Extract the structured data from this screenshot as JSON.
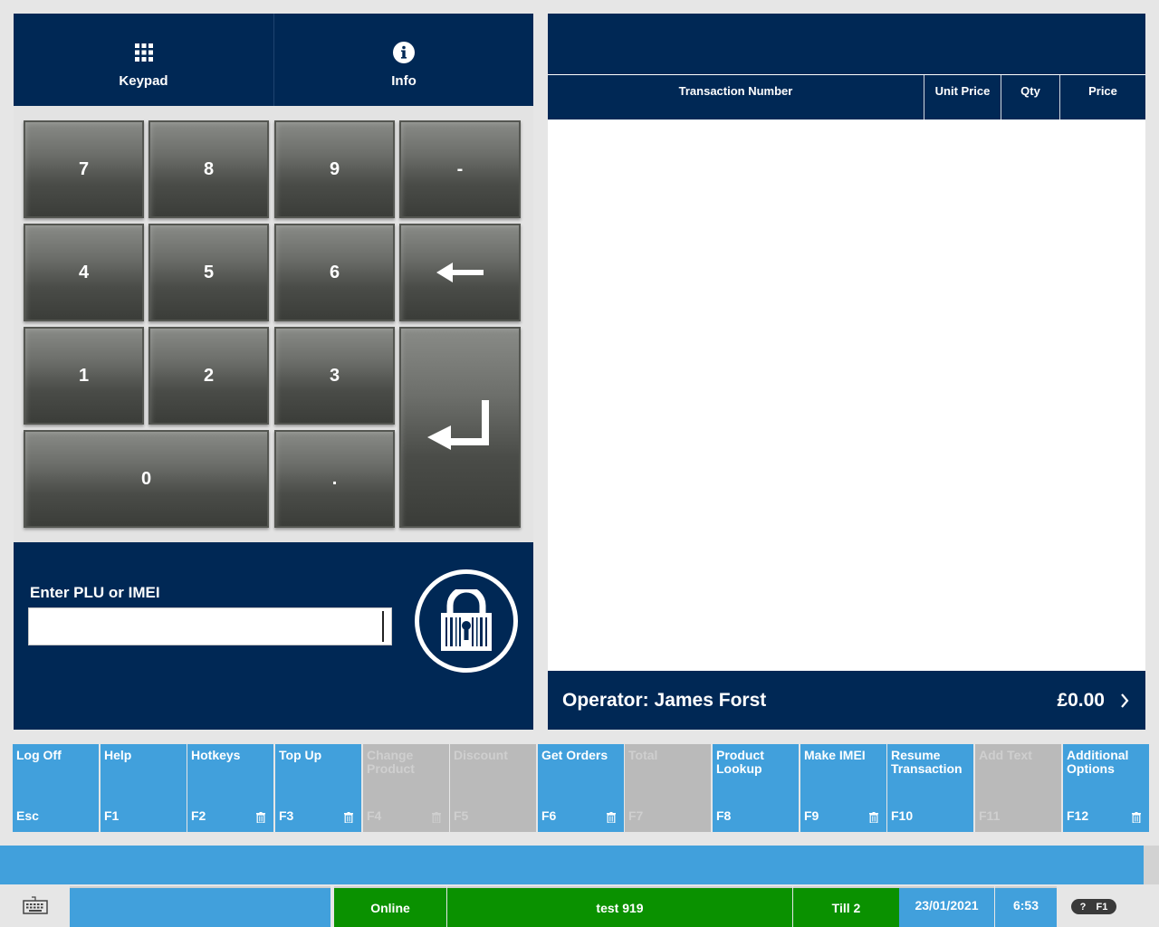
{
  "tabs": [
    {
      "label": "Keypad",
      "icon": "grid-icon"
    },
    {
      "label": "Info",
      "icon": "info-icon"
    }
  ],
  "keypad": {
    "keys": [
      "7",
      "8",
      "9",
      "-",
      "4",
      "5",
      "6",
      "backspace",
      "1",
      "2",
      "3",
      "enter",
      "0",
      "."
    ]
  },
  "plu": {
    "label": "Enter PLU or IMEI",
    "value": "",
    "placeholder": ""
  },
  "transaction": {
    "columns": [
      "Transaction Number",
      "Unit Price",
      "Qty",
      "Price"
    ],
    "rows": [],
    "operator": "Operator: James Forst",
    "total": "£0.00"
  },
  "function_keys": [
    {
      "label": "Log Off",
      "key": "Esc",
      "enabled": true,
      "icon": ""
    },
    {
      "label": "Help",
      "key": "F1",
      "enabled": true,
      "icon": ""
    },
    {
      "label": "Hotkeys",
      "key": "F2",
      "enabled": true,
      "icon": "trash-icon"
    },
    {
      "label": "Top Up",
      "key": "F3",
      "enabled": true,
      "icon": "trash-icon"
    },
    {
      "label": "Change Product",
      "key": "F4",
      "enabled": false,
      "icon": "trash-icon"
    },
    {
      "label": "Discount",
      "key": "F5",
      "enabled": false,
      "icon": ""
    },
    {
      "label": "Get Orders",
      "key": "F6",
      "enabled": true,
      "icon": "trash-icon"
    },
    {
      "label": "Total",
      "key": "F7",
      "enabled": false,
      "icon": ""
    },
    {
      "label": "Product Lookup",
      "key": "F8",
      "enabled": true,
      "icon": ""
    },
    {
      "label": "Make IMEI",
      "key": "F9",
      "enabled": true,
      "icon": "trash-icon"
    },
    {
      "label": "Resume Transaction",
      "key": "F10",
      "enabled": true,
      "icon": ""
    },
    {
      "label": "Add Text",
      "key": "F11",
      "enabled": false,
      "icon": ""
    },
    {
      "label": "Additional Options",
      "key": "F12",
      "enabled": true,
      "icon": "trash-icon"
    }
  ],
  "status": {
    "connection": "Online",
    "user": "test 919",
    "till": "Till 2",
    "date": "23/01/2021",
    "time": "6:53",
    "help_q": "?",
    "help_key": "F1"
  },
  "colors": {
    "navy": "#002855",
    "accent_blue": "#41a0dc",
    "disabled_grey": "#bababa",
    "status_green": "#0a9100"
  }
}
